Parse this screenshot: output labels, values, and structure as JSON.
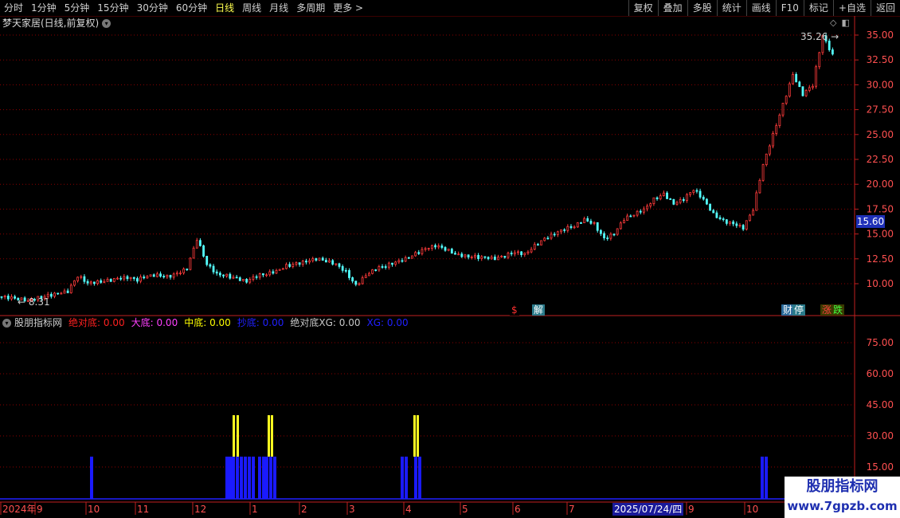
{
  "toolbar": {
    "periods": [
      "分时",
      "1分钟",
      "5分钟",
      "15分钟",
      "30分钟",
      "60分钟",
      "日线",
      "周线",
      "月线",
      "多周期",
      "更多 >"
    ],
    "active_period": "日线",
    "right_buttons": [
      "复权",
      "叠加",
      "多股",
      "统计",
      "画线",
      "F10",
      "标记",
      "+自选",
      "返回"
    ]
  },
  "stock": {
    "title": "梦天家居(日线,前复权)"
  },
  "price_axis": {
    "labels": [
      "35.00",
      "32.50",
      "30.00",
      "27.50",
      "25.00",
      "22.50",
      "20.00",
      "17.50",
      "15.00",
      "12.50",
      "10.00"
    ]
  },
  "annotations": {
    "high_label": "35.26",
    "low_label": "8.31",
    "current_price": "15.60"
  },
  "events": [
    {
      "label": "$",
      "color": "#ff3030",
      "bg": "#000"
    },
    {
      "label": "解",
      "color": "#ffffff",
      "bg": "#2a7a8a"
    },
    {
      "label": "财",
      "color": "#ffffff",
      "bg": "#2a6a9a"
    },
    {
      "label": "停",
      "color": "#ffffff",
      "bg": "#2a7a8a"
    },
    {
      "label": "涨",
      "color": "#ff4040",
      "bg": "#3a3a00"
    },
    {
      "label": "跌",
      "color": "#40ff40",
      "bg": "#3a3a00"
    }
  ],
  "indicator": {
    "name": "股朋指标网",
    "items": [
      {
        "label": "绝对底:",
        "value": "0.00",
        "color": "#ff2020"
      },
      {
        "label": "大底:",
        "value": "0.00",
        "color": "#ff40ff"
      },
      {
        "label": "中底:",
        "value": "0.00",
        "color": "#ffff00"
      },
      {
        "label": "抄底:",
        "value": "0.00",
        "color": "#2020ff"
      },
      {
        "label": "绝对底XG:",
        "value": "0.00",
        "color": "#c8c8c8"
      },
      {
        "label": "XG:",
        "value": "0.00",
        "color": "#2020ff"
      }
    ],
    "axis_labels": [
      "75.00",
      "60.00",
      "45.00",
      "30.00",
      "15.00"
    ]
  },
  "time_axis": {
    "labels": [
      "2024年",
      "9",
      "10",
      "11",
      "12",
      "1",
      "2",
      "3",
      "4",
      "5",
      "6",
      "7",
      "9",
      "10"
    ],
    "cursor_date": "2025/07/24/四"
  },
  "watermark": {
    "line1": "股朋指标网",
    "line2": "www.7gpzb.com"
  },
  "colors": {
    "up": "#ff3b3b",
    "down": "#54ffff",
    "grid": "#8b0000",
    "axis": "#c02020"
  },
  "chart_data": {
    "type": "candlestick",
    "price_range": [
      8.0,
      36.0
    ],
    "close_series": [
      8.7,
      8.6,
      8.5,
      8.31,
      8.6,
      8.8,
      9.0,
      9.2,
      10.8,
      10.1,
      10.2,
      10.3,
      10.5,
      10.6,
      10.4,
      10.8,
      10.9,
      10.7,
      11.0,
      11.5,
      14.5,
      12.0,
      11.0,
      10.8,
      10.5,
      10.2,
      10.8,
      11.0,
      11.3,
      11.8,
      12.0,
      12.2,
      12.5,
      12.3,
      12.0,
      11.2,
      9.8,
      10.8,
      11.5,
      11.8,
      12.2,
      12.5,
      13.0,
      13.5,
      13.8,
      13.5,
      13.0,
      12.8,
      12.7,
      12.6,
      12.5,
      12.8,
      13.2,
      13.0,
      13.8,
      14.5,
      15.0,
      15.5,
      15.8,
      16.5,
      16.0,
      14.5,
      15.0,
      16.5,
      17.0,
      17.5,
      18.5,
      19.0,
      18.0,
      18.5,
      19.5,
      18.5,
      17.0,
      16.3,
      16.0,
      15.6,
      17.5,
      22.0,
      25.0,
      28.0,
      31.0,
      29.0,
      30.0,
      35.0,
      33.0
    ],
    "indicator_bars": {
      "blue_groups": [
        "2024-09-20",
        "2024-12 (5 bars)",
        "2025-01 (2 bars)",
        "2025-03-31",
        "2025-04-09",
        "2025-09-26",
        "2025-09-29",
        "2025-10-14"
      ],
      "blue_level": 20,
      "yellow_groups": [
        "2024-12-23",
        "2024-12-24",
        "2025-01-13",
        "2025-04-09"
      ],
      "yellow_level": 40
    }
  }
}
